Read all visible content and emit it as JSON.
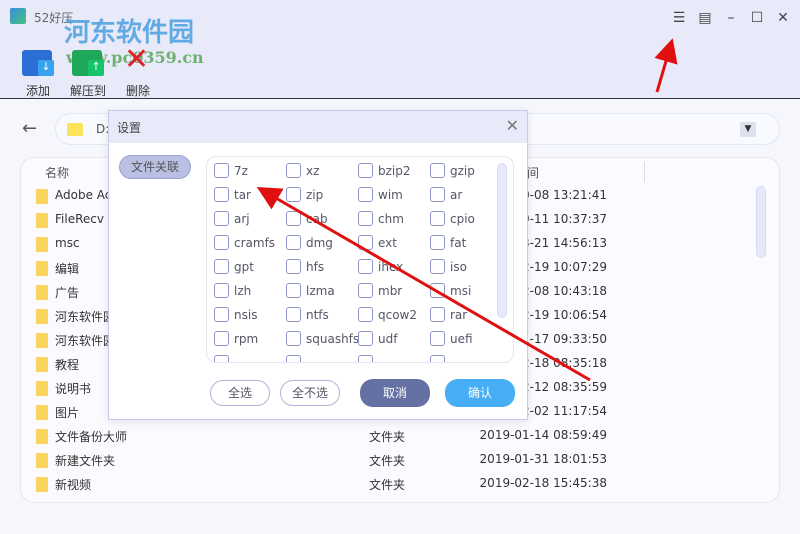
{
  "app": {
    "title": "52好压",
    "watermark": {
      "name": "河东软件园",
      "url": "www.pc0359.cn"
    }
  },
  "toolbar": [
    {
      "label": "添加",
      "icon": "add-archive-icon"
    },
    {
      "label": "解压到",
      "icon": "extract-icon"
    },
    {
      "label": "删除",
      "icon": "delete-icon"
    }
  ],
  "titlebar_icons": [
    "menu-list-icon",
    "feedback-icon",
    "minimize-icon",
    "maximize-icon",
    "close-icon"
  ],
  "address": {
    "path": "D:"
  },
  "list": {
    "headers": {
      "name": "名称",
      "time": "间"
    },
    "rows": [
      {
        "name": "Adobe Ac",
        "type": "",
        "date": "0-08 13:21:41"
      },
      {
        "name": "FileRecv",
        "type": "",
        "date": "9-11 10:37:37"
      },
      {
        "name": "msc",
        "type": "",
        "date": "3-21 14:56:13"
      },
      {
        "name": "编辑",
        "type": "",
        "date": "2-19 10:07:29"
      },
      {
        "name": "广告",
        "type": "",
        "date": "2-08 10:43:18"
      },
      {
        "name": "河东软件园",
        "type": "",
        "date": "2-19 10:06:54"
      },
      {
        "name": "河东软件园",
        "type": "",
        "date": "1-17 09:33:50"
      },
      {
        "name": "教程",
        "type": "",
        "date": "2-18 08:35:18"
      },
      {
        "name": "说明书",
        "type": "",
        "date": "2-12 08:35:59"
      },
      {
        "name": "图片",
        "type": "",
        "date": "2-02 11:17:54"
      },
      {
        "name": "文件备份大师",
        "type": "文件夹",
        "date": "2019-01-14 08:59:49"
      },
      {
        "name": "新建文件夹",
        "type": "文件夹",
        "date": "2019-01-31 18:01:53"
      },
      {
        "name": "新视频",
        "type": "文件夹",
        "date": "2019-02-18 15:45:38"
      }
    ]
  },
  "dialog": {
    "title": "设置",
    "tab": "文件关联",
    "formats": [
      "7z",
      "xz",
      "bzip2",
      "gzip",
      "tar",
      "zip",
      "wim",
      "ar",
      "arj",
      "cab",
      "chm",
      "cpio",
      "cramfs",
      "dmg",
      "ext",
      "fat",
      "gpt",
      "hfs",
      "ihex",
      "iso",
      "lzh",
      "lzma",
      "mbr",
      "msi",
      "nsis",
      "ntfs",
      "qcow2",
      "rar",
      "rpm",
      "squashfs",
      "udf",
      "uefi"
    ],
    "select_all": "全选",
    "select_none": "全不选",
    "cancel": "取消",
    "ok": "确认"
  },
  "colors": {
    "accent": "#45aef5",
    "cancel": "#6571a3",
    "arrow": "#e01010"
  }
}
